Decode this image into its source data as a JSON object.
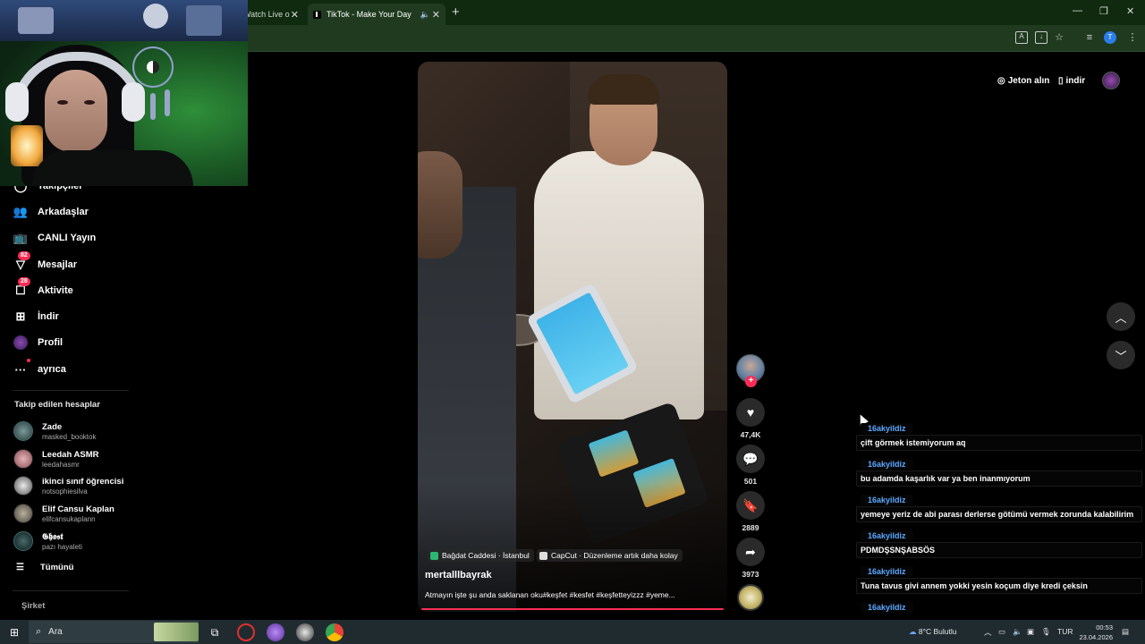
{
  "browser": {
    "tabs": [
      {
        "label": "Watch Live o"
      },
      {
        "label": "TikTok - Make Your Day"
      }
    ],
    "new_tab": "+",
    "profile_initial": "T"
  },
  "sidebar": {
    "partial_item": "Takipçiler",
    "items": [
      {
        "label": "Arkadaşlar",
        "icon": "friends-icon",
        "badge": ""
      },
      {
        "label": "CANLI Yayın",
        "icon": "live-tv-icon",
        "badge": ""
      },
      {
        "label": "Mesajlar",
        "icon": "messages-icon",
        "badge": "82"
      },
      {
        "label": "Aktivite",
        "icon": "activity-icon",
        "badge": "28"
      },
      {
        "label": "İndir",
        "icon": "download-plus-icon",
        "badge": ""
      },
      {
        "label": "Profil",
        "icon": "profile-avatar-icon",
        "badge": ""
      },
      {
        "label": "ayrıca",
        "icon": "more-dots-icon",
        "badge": ""
      }
    ],
    "following_title": "Takip edilen hesaplar",
    "following": [
      {
        "name": "Zade",
        "username": "masked_booktok"
      },
      {
        "name": "Leedah ASMR",
        "username": "leedahasmr"
      },
      {
        "name": "ikinci sınıf öğrencisi",
        "username": "notsophiesilva"
      },
      {
        "name": "Elif Cansu Kaplan",
        "username": "elifcansukaplann"
      },
      {
        "name": "𝕲𝖍𝖔𝖘𝖙",
        "username": "pazı hayaleti"
      }
    ],
    "see_all": "Tümünü",
    "company": "Şirket"
  },
  "header": {
    "coins_label": "Jeton alın",
    "download_label": "indir"
  },
  "video": {
    "location_chip": "Bağdat Caddesi · İstanbul",
    "capcut_chip": "CapCut · Düzenleme artık daha kolay",
    "author": "mertalllbayrak",
    "description": "Atmayın işte şu anda saklanan oku#keşfet #kesfet #keşfetteyizzz #yeme..."
  },
  "actions": {
    "likes": "47,4K",
    "comments": "501",
    "saves": "2889",
    "shares": "3973"
  },
  "chat": [
    {
      "user": "16akyildiz",
      "message": "çift görmek istemiyorum aq"
    },
    {
      "user": "16akyildiz",
      "message": "bu adamda kaşarlık var ya ben inanmıyorum"
    },
    {
      "user": "16akyildiz",
      "message": "yemeye yeriz de abi parası derlerse götümü vermek zorunda kalabilirim"
    },
    {
      "user": "16akyildiz",
      "message": "PDMDŞSNŞABSÖS"
    },
    {
      "user": "16akyildiz",
      "message": "Tuna tavus givi annem yokki yesin koçum diye kredi çeksin"
    },
    {
      "user": "16akyildiz",
      "message": ""
    }
  ],
  "taskbar": {
    "search_placeholder": "Ara",
    "weather": "8°C  Bulutlu",
    "language": "TUR",
    "time": "00:53",
    "date": "23.04.2026"
  },
  "colors": {
    "accent": "#fe2c55",
    "chat_username": "#5ba8ff",
    "browser_frame": "#1f3a1f"
  }
}
